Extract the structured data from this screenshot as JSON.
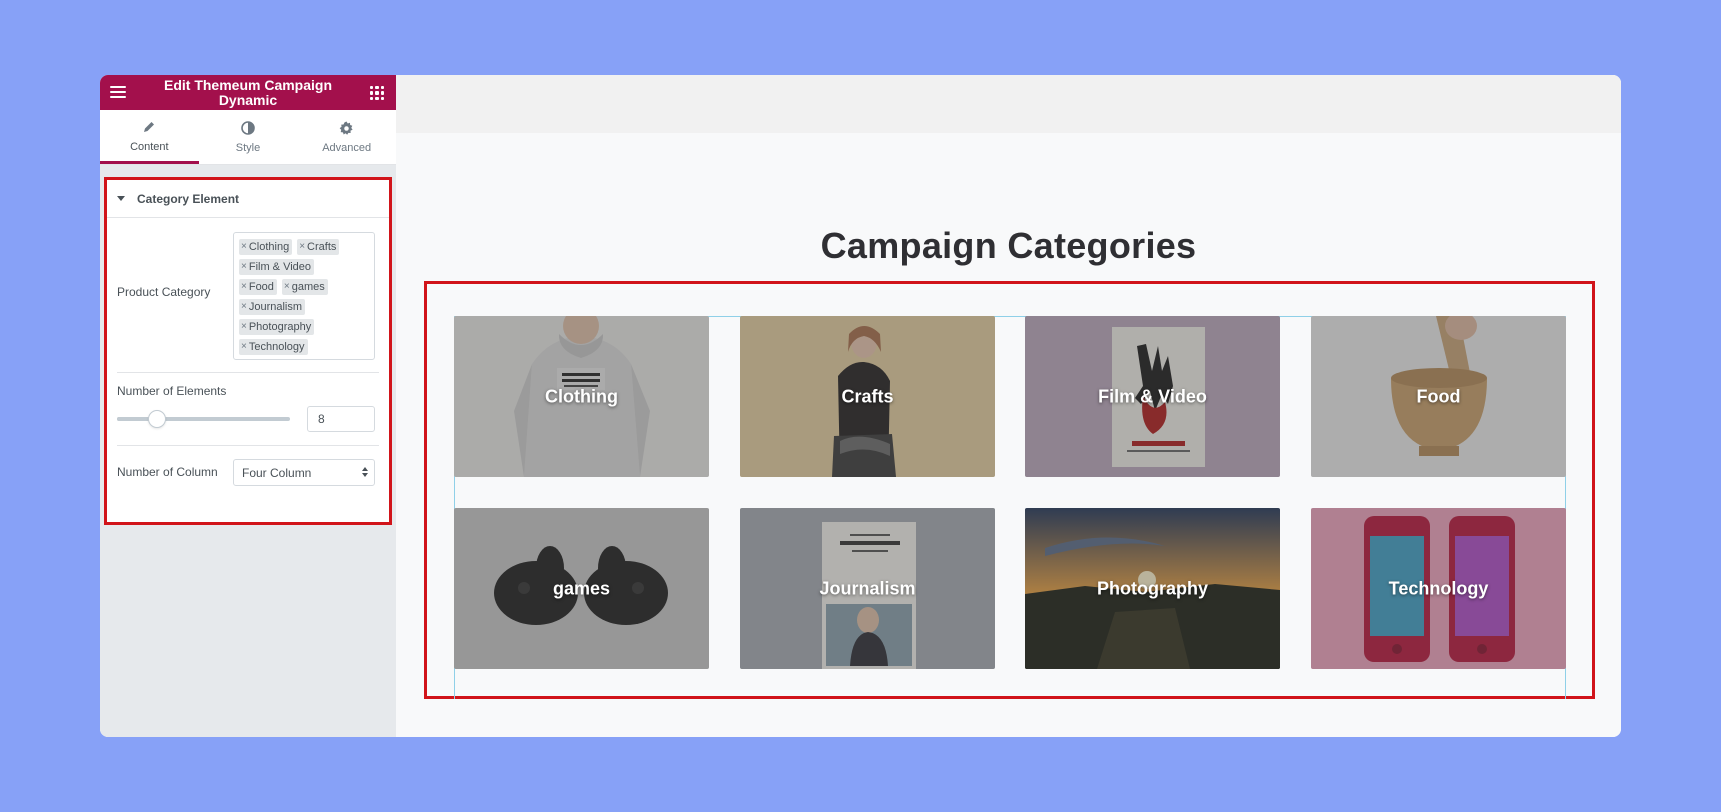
{
  "sidebar": {
    "title": "Edit Themeum Campaign Dynamic",
    "tabs": [
      {
        "label": "Content"
      },
      {
        "label": "Style"
      },
      {
        "label": "Advanced"
      }
    ],
    "section_title": "Category Element",
    "product_category": {
      "label": "Product Category",
      "tags": [
        "Clothing",
        "Crafts",
        "Film & Video",
        "Food",
        "games",
        "Journalism",
        "Photography",
        "Technology"
      ]
    },
    "number_of_elements": {
      "label": "Number of Elements",
      "value": "8",
      "slider_fraction": 0.2
    },
    "number_of_column": {
      "label": "Number of Column",
      "selected": "Four Column"
    }
  },
  "preview": {
    "heading": "Campaign Categories",
    "categories": [
      {
        "label": "Clothing"
      },
      {
        "label": "Crafts"
      },
      {
        "label": "Film & Video"
      },
      {
        "label": "Food"
      },
      {
        "label": "games"
      },
      {
        "label": "Journalism"
      },
      {
        "label": "Photography"
      },
      {
        "label": "Technology"
      }
    ]
  },
  "colors": {
    "brand": "#a3104c",
    "highlight_border": "#d1141a",
    "editor_accent": "#71d7f7",
    "background": "#87a1f7"
  }
}
